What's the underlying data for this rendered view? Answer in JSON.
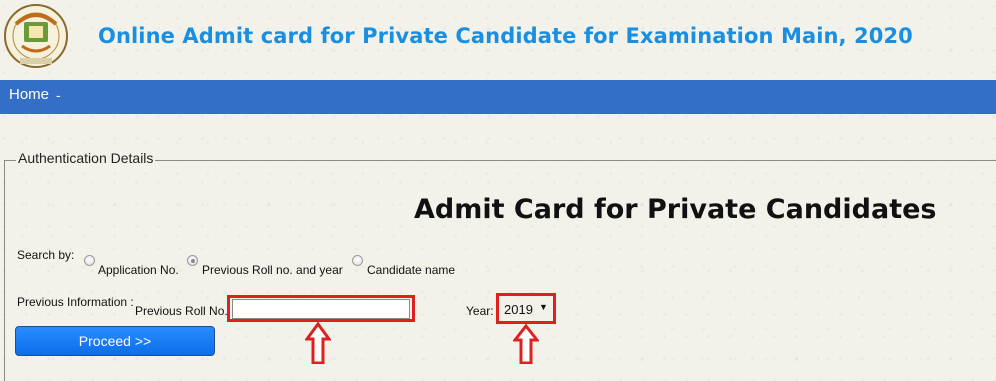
{
  "header": {
    "title": "Online Admit card for Private Candidate for Examination Main, 2020",
    "logo_icon": "cbse-emblem-icon"
  },
  "nav": {
    "home_label": "Home",
    "separator": "-"
  },
  "form": {
    "legend": "Authentication Details",
    "heading": "Admit Card for Private Candidates",
    "search_by_label": "Search by:",
    "radio_options": [
      {
        "label": "Application No.",
        "checked": false
      },
      {
        "label": "Previous Roll no. and year",
        "checked": true
      },
      {
        "label": "Candidate name",
        "checked": false
      }
    ],
    "previous_info_label": "Previous Information :",
    "roll_no_label": "Previous Roll No.",
    "roll_no_value": "",
    "year_label": "Year:",
    "year_value": "2019",
    "proceed_label": "Proceed >>"
  },
  "annotations": {
    "color": "#e02020",
    "arrow_icon": "up-arrow-icon"
  },
  "colors": {
    "nav_bg": "#336fc6",
    "title": "#1a8ee0",
    "button": "#1a7df5"
  }
}
